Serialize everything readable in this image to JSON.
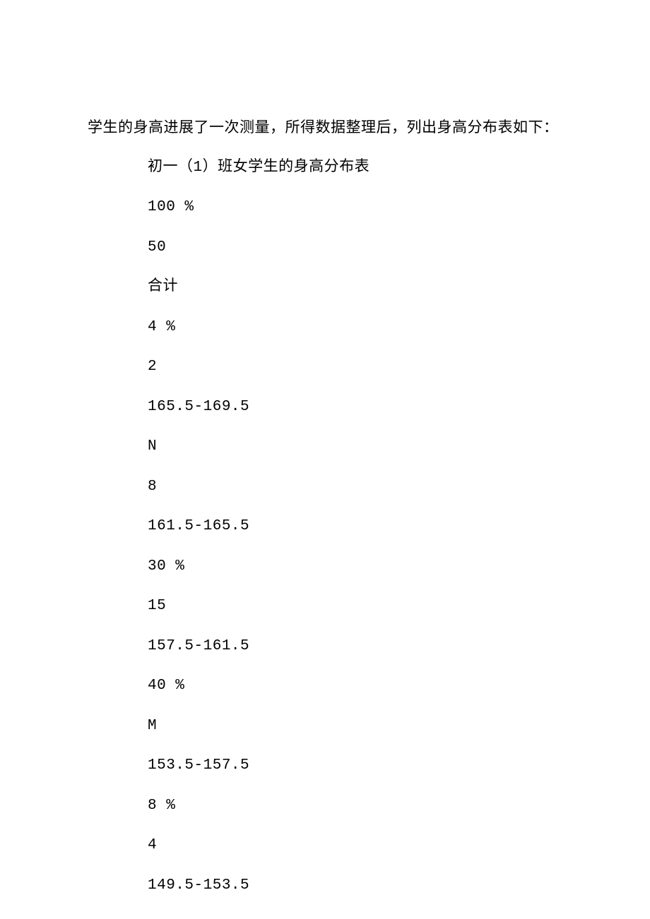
{
  "intro": "学生的身高进展了一次测量，所得数据整理后，列出身高分布表如下：",
  "lines": [
    "初一（1）班女学生的身高分布表",
    "100 %",
    "50",
    "合计",
    "4 %",
    "2",
    "165.5-169.5",
    "N",
    "8",
    "161.5-165.5",
    "30 %",
    "15",
    "157.5-161.5",
    "40 %",
    "M",
    "153.5-157.5",
    "8 %",
    "4",
    "149.5-153.5"
  ]
}
